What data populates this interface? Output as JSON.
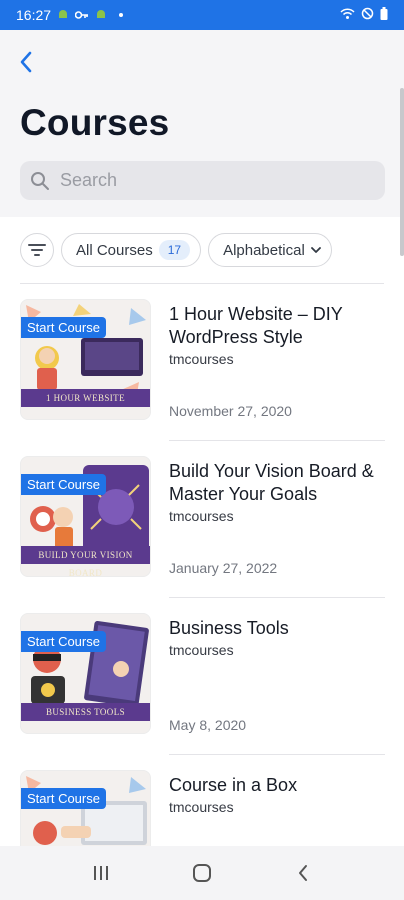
{
  "status_bar": {
    "time": "16:27",
    "icons": [
      "android-icon",
      "key-icon",
      "android-icon",
      "wifi-icon",
      "dnd-icon",
      "battery-icon"
    ]
  },
  "header": {
    "title": "Courses",
    "search": {
      "placeholder": "Search",
      "value": ""
    }
  },
  "filters": {
    "all_courses_label": "All Courses",
    "count": "17",
    "sort_label": "Alphabetical"
  },
  "courses": [
    {
      "title": "1 Hour Website – DIY WordPress Style",
      "author": "tmcourses",
      "date": "November 27, 2020",
      "badge": "Start Course",
      "thumb_caption": "1 HOUR WEBSITE"
    },
    {
      "title": "Build Your Vision Board & Master Your Goals",
      "author": "tmcourses",
      "date": "January 27, 2022",
      "badge": "Start Course",
      "thumb_caption": "BUILD YOUR VISION BOARD"
    },
    {
      "title": "Business Tools",
      "author": "tmcourses",
      "date": "May 8, 2020",
      "badge": "Start Course",
      "thumb_caption": "BUSINESS TOOLS"
    },
    {
      "title": "Course in a Box",
      "author": "tmcourses",
      "date": "",
      "badge": "Start Course",
      "thumb_caption": ""
    }
  ],
  "colors": {
    "accent": "#1f73e6",
    "header_bg": "#f5f5f7",
    "banner": "#5b3a8e"
  }
}
